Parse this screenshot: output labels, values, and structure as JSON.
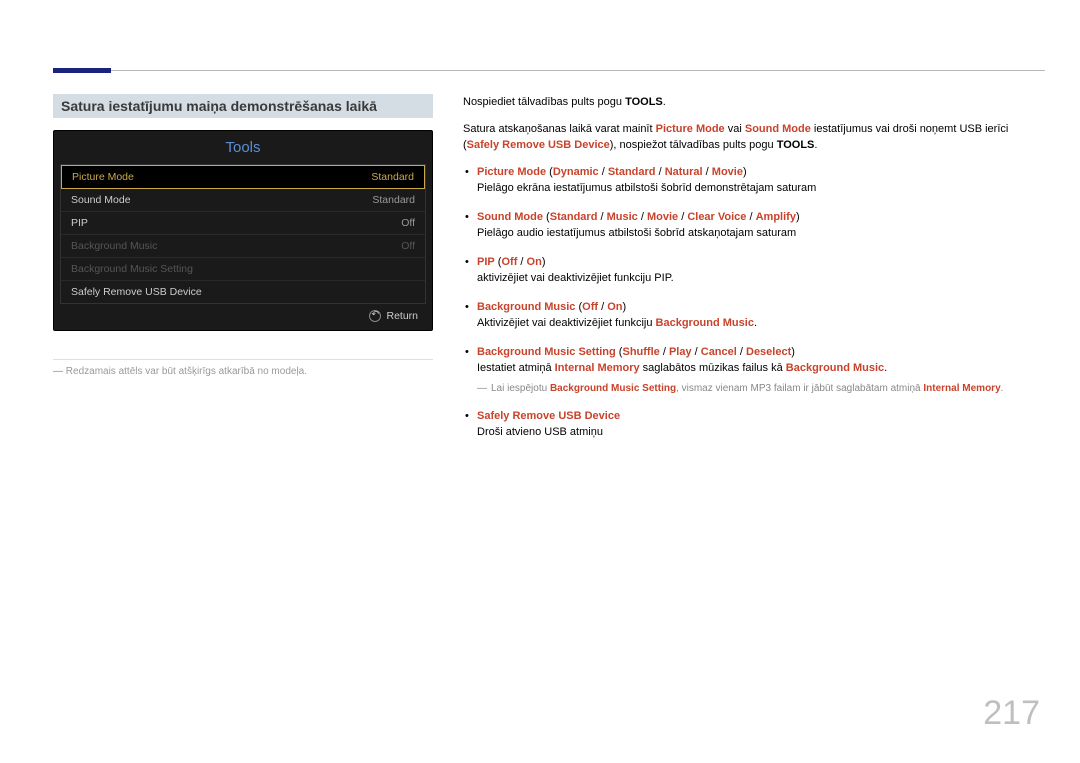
{
  "page_number": "217",
  "section_title": "Satura iestatījumu maiņa demonstrēšanas laikā",
  "tools": {
    "title": "Tools",
    "rows": [
      {
        "label": "Picture Mode",
        "value": "Standard",
        "state": "sel"
      },
      {
        "label": "Sound Mode",
        "value": "Standard",
        "state": ""
      },
      {
        "label": "PIP",
        "value": "Off",
        "state": ""
      },
      {
        "label": "Background Music",
        "value": "Off",
        "state": "dim"
      },
      {
        "label": "Background Music Setting",
        "value": "",
        "state": "dim"
      },
      {
        "label": "Safely Remove USB Device",
        "value": "",
        "state": ""
      }
    ],
    "return": "Return"
  },
  "caption": "Redzamais attēls var būt atšķirīgs atkarībā no modeļa.",
  "intro": {
    "line1_a": "Nospiediet tālvadības pults pogu ",
    "line1_b": "TOOLS",
    "line1_c": ".",
    "line2_a": "Satura atskaņošanas laikā varat mainīt ",
    "pm": "Picture Mode",
    "or": " vai ",
    "sm": "Sound Mode",
    "line2_b": " iestatījumus vai droši noņemt USB ierīci (",
    "sr": "Safely Remove USB Device",
    "line2_c": "), nospiežot tālvadības pults pogu ",
    "line2_d": "TOOLS",
    "line2_e": "."
  },
  "items": {
    "i1": {
      "head": "Picture Mode",
      "opts_a": "Dynamic",
      "opts_b": "Standard",
      "opts_c": "Natural",
      "opts_d": "Movie",
      "desc": "Pielāgo ekrāna iestatījumus atbilstoši šobrīd demonstrētajam saturam"
    },
    "i2": {
      "head": "Sound Mode",
      "opts_a": "Standard",
      "opts_b": "Music",
      "opts_c": "Movie",
      "opts_d": "Clear Voice",
      "opts_e": "Amplify",
      "desc": "Pielāgo audio iestatījumus atbilstoši šobrīd atskaņotajam saturam"
    },
    "i3": {
      "head": "PIP",
      "opts_a": "Off",
      "opts_b": "On",
      "desc": "aktivizējiet vai deaktivizējiet funkciju PIP."
    },
    "i4": {
      "head": "Background Music",
      "opts_a": "Off",
      "opts_b": "On",
      "desc_a": "Aktivizējiet vai deaktivizējiet funkciju ",
      "desc_b": "Background Music",
      "desc_c": "."
    },
    "i5": {
      "head": "Background Music Setting",
      "opts_a": "Shuffle",
      "opts_b": "Play",
      "opts_c": "Cancel",
      "opts_d": "Deselect",
      "desc_a": "Iestatiet atmiņā ",
      "desc_b": "Internal Memory",
      "desc_c": " saglabātos mūzikas failus kā ",
      "desc_d": "Background Music",
      "desc_e": ".",
      "note_a": "Lai iespējotu ",
      "note_b": "Background Music Setting",
      "note_c": ", vismaz vienam MP3 failam ir jābūt saglabātam atmiņā ",
      "note_d": "Internal Memory",
      "note_e": "."
    },
    "i6": {
      "head": "Safely Remove USB Device",
      "desc": "Droši atvieno USB atmiņu"
    }
  }
}
